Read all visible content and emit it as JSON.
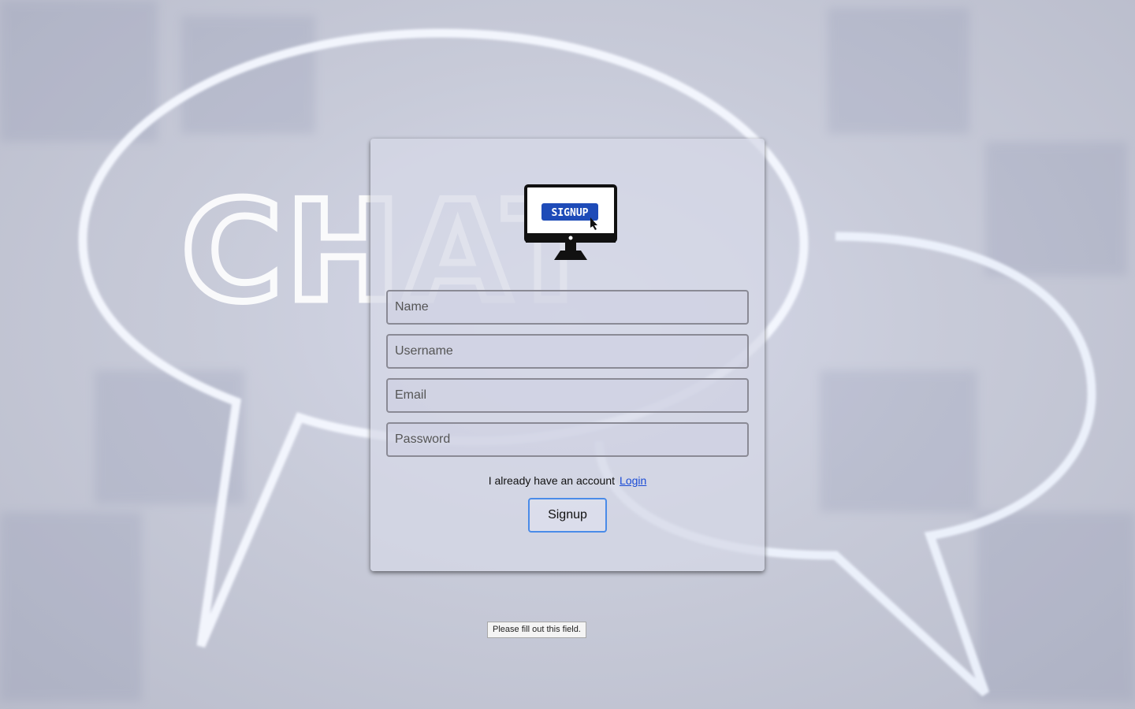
{
  "background": {
    "watermark_text": "CHAT"
  },
  "form": {
    "logo": {
      "icon": "monitor-signup-icon",
      "badge_text": "SIGNUP"
    },
    "fields": [
      {
        "name": "name",
        "placeholder": "Name",
        "value": ""
      },
      {
        "name": "username",
        "placeholder": "Username",
        "value": ""
      },
      {
        "name": "email",
        "placeholder": "Email",
        "value": ""
      },
      {
        "name": "password",
        "placeholder": "Password",
        "value": ""
      }
    ],
    "account_text": "I already have an account",
    "login_link": "Login",
    "submit_label": "Signup"
  },
  "validation": {
    "tooltip": "Please fill out this field."
  },
  "colors": {
    "link": "#1a4bd6",
    "button_border": "#4a8be8",
    "logo_badge": "#1e4bb8"
  }
}
